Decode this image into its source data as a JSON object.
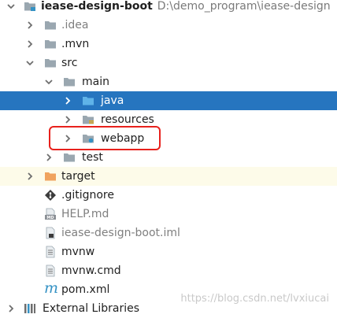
{
  "project": {
    "name": "iease-design-boot",
    "path": "D:\\demo_program\\iease-design"
  },
  "tree": {
    "idea": ".idea",
    "mvn": ".mvn",
    "src": "src",
    "main": "main",
    "java": "java",
    "resources": "resources",
    "webapp": "webapp",
    "test": "test",
    "target": "target",
    "gitignore": ".gitignore",
    "help_md": "HELP.md",
    "iml": "iease-design-boot.iml",
    "mvnw": "mvnw",
    "mvnw_cmd": "mvnw.cmd",
    "pom": "pom.xml",
    "external_libraries": "External Libraries"
  },
  "icon_badges": {
    "md": "MD",
    "maven": "m"
  },
  "selection": {
    "selected_item": "java",
    "highlighted_item": "webapp"
  },
  "colors": {
    "selection_bg": "#2675bf",
    "highlight_border": "#e8211c",
    "folder": "#9aa7b0",
    "target_folder": "#f0a35e",
    "java_folder": "#3592c4"
  },
  "watermark": "https://blog.csdn.net/lvxiucai"
}
